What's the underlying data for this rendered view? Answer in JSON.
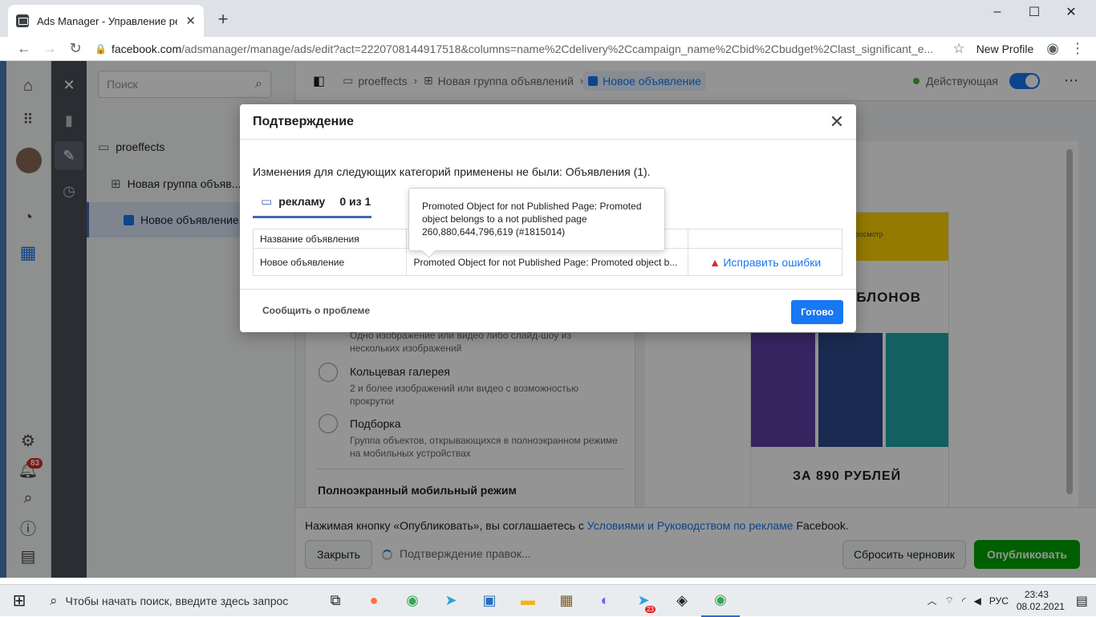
{
  "browser": {
    "tab_title": "Ads Manager - Управление рек",
    "url_host": "facebook.com",
    "url_path": "/adsmanager/manage/ads/edit?act=2220708144917518&columns=name%2Cdelivery%2Ccampaign_name%2Cbid%2Cbudget%2Clast_significant_e...",
    "profile": "New Profile"
  },
  "sidebar": {
    "notifications_count": "83",
    "search_placeholder": "Поиск",
    "tree": {
      "campaign": "proeffects",
      "adset": "Новая группа объяв...",
      "ad": "Новое объявление"
    }
  },
  "topbar": {
    "crumb_campaign": "proeffects",
    "crumb_adset": "Новая группа объявлений",
    "crumb_ad": "Новое объявление",
    "status": "Действующая"
  },
  "form": {
    "option0_desc": "Одно изображение или видео либо слайд-шоу из нескольких изображений",
    "option1_title": "Кольцевая галерея",
    "option1_desc": "2 и более изображений или видео с возможностью прокрутки",
    "option2_title": "Подборка",
    "option2_desc": "Группа объектов, открывающихся в полноэкранном режиме на мобильных устройствах",
    "section_title": "Полноэкранный мобильный режим"
  },
  "preview": {
    "caption_top": "шаблонов",
    "caption_bottom": "ЗА 890 РУБЛЕЙ",
    "label": "росмотр"
  },
  "footer": {
    "terms_prefix": "Нажимая кнопку «Опубликовать», вы соглашаетесь с ",
    "terms_link": "Условиями и Руководством по рекламе",
    "terms_suffix": " Facebook.",
    "close_label": "Закрыть",
    "status_text": "Подтверждение правок...",
    "reset_label": "Сбросить черновик",
    "publish_label": "Опубликовать"
  },
  "dialog": {
    "title": "Подтверждение",
    "message": "Изменения для следующих категорий применены не были: Объявления (1).",
    "tab_label": "рекламу",
    "tab_count": "0 из 1",
    "col_name": "Название объявления",
    "row_name": "Новое объявление",
    "row_error": "Promoted Object for not Published Page: Promoted object b...",
    "fix_label": "Исправить ошибки",
    "tooltip": "Promoted Object for not Published Page: Promoted object belongs to a not published page 260,880,644,796,619 (#1815014)",
    "report_label": "Сообщить о проблеме",
    "done_label": "Готово"
  },
  "taskbar": {
    "search_placeholder": "Чтобы начать поиск, введите здесь запрос",
    "lang": "РУС",
    "time": "23:43",
    "date": "08.02.2021",
    "telegram_badge": "23"
  },
  "colors": {
    "accent": "#1877f2",
    "publish": "#00a400",
    "error": "#e02424"
  }
}
